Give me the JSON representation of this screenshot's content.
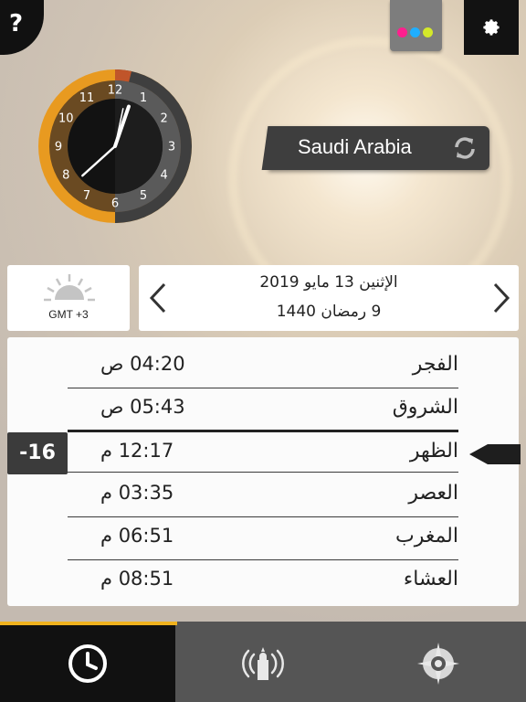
{
  "header": {
    "help_label": "?",
    "palette_colors": [
      "#ff1f8e",
      "#1faeff",
      "#d4e82a"
    ]
  },
  "clock": {
    "numbers": [
      "12",
      "1",
      "2",
      "3",
      "4",
      "5",
      "6",
      "7",
      "8",
      "9",
      "10",
      "11"
    ],
    "hour": 12,
    "minute": 38,
    "second": 2
  },
  "location": {
    "country": "Saudi Arabia"
  },
  "timezone": {
    "label": "GMT +3"
  },
  "date": {
    "gregorian": "الإثنين 13 مايو 2019",
    "hijri": "9 رمضان 1440"
  },
  "prayers": [
    {
      "name": "الفجر",
      "time": "04:20 ص"
    },
    {
      "name": "الشروق",
      "time": "05:43 ص"
    },
    {
      "name": "الظهر",
      "time": "12:17 م"
    },
    {
      "name": "العصر",
      "time": "03:35 م"
    },
    {
      "name": "المغرب",
      "time": "06:51 م"
    },
    {
      "name": "العشاء",
      "time": "08:51 م"
    }
  ],
  "next_prayer": {
    "offset": "-16"
  },
  "tabs": [
    {
      "icon": "clock-icon",
      "active": true
    },
    {
      "icon": "adhan-icon",
      "active": false
    },
    {
      "icon": "compass-icon",
      "active": false
    }
  ],
  "accent_color": "#f0b21e"
}
